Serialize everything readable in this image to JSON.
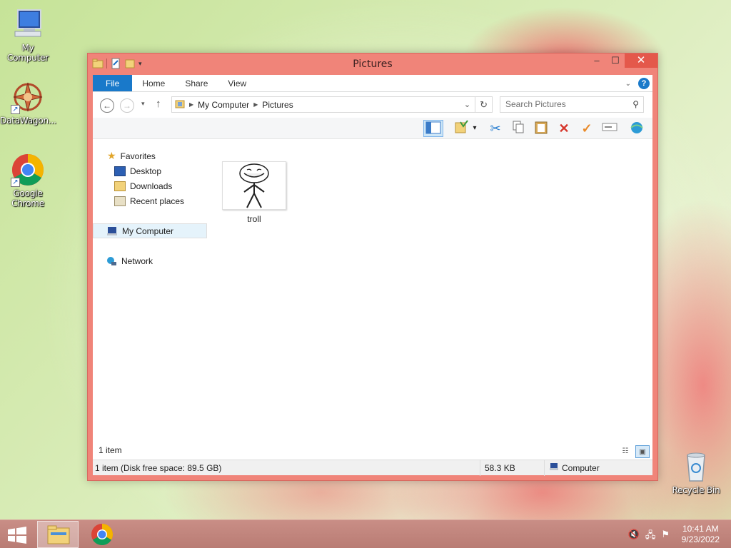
{
  "desktop": {
    "icons": [
      {
        "label": "My Computer"
      },
      {
        "label": "DataWagon..."
      },
      {
        "label": "Google Chrome"
      },
      {
        "label": "Recycle Bin"
      }
    ]
  },
  "window": {
    "title": "Pictures",
    "ribbon_tabs": [
      "File",
      "Home",
      "Share",
      "View"
    ],
    "address": {
      "crumbs": [
        "My Computer",
        "Pictures"
      ]
    },
    "search": {
      "placeholder": "Search Pictures"
    },
    "nav": {
      "favorites": "Favorites",
      "favorites_items": [
        "Desktop",
        "Downloads",
        "Recent places"
      ],
      "computer": "My Computer",
      "network": "Network"
    },
    "files": [
      {
        "name": "troll"
      }
    ],
    "item_count": "1 item",
    "status": {
      "summary": "1 item (Disk free space: 89.5 GB)",
      "size": "58.3 KB",
      "location": "Computer"
    }
  },
  "taskbar": {
    "clock_time": "10:41 AM",
    "clock_date": "9/23/2022"
  },
  "colors": {
    "window_frame": "#f08479",
    "close_button": "#e4584b",
    "file_tab": "#1979ca"
  }
}
